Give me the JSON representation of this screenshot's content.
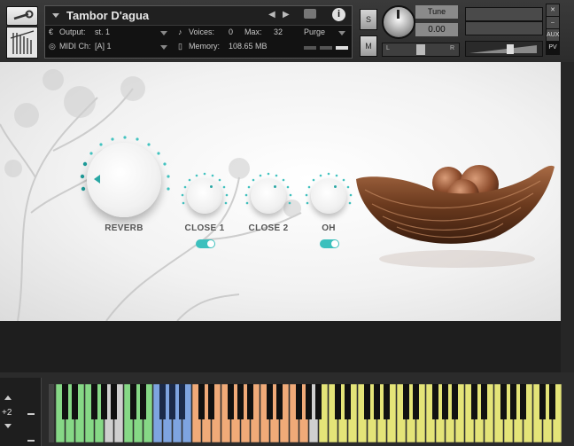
{
  "header": {
    "instrument_name": "Tambor D'agua",
    "output_label": "Output:",
    "output_value": "st. 1",
    "midi_label": "MIDI Ch:",
    "midi_value": "[A] 1",
    "voices_label": "Voices:",
    "voices_value": "0",
    "max_label": "Max:",
    "max_value": "32",
    "memory_label": "Memory:",
    "memory_value": "108.65 MB",
    "purge_label": "Purge",
    "solo_label": "S",
    "mute_label": "M",
    "tune_label": "Tune",
    "tune_value": "0.00",
    "pan_left": "L",
    "pan_right": "R",
    "aux_label": "AUX",
    "pv_label": "PV"
  },
  "controls": {
    "reverb_label": "REVERB",
    "close1_label": "CLOSE 1",
    "close2_label": "CLOSE 2",
    "oh_label": "OH"
  },
  "keyboard": {
    "octave_value": "+2"
  },
  "colors": {
    "accent": "#3cc0bd",
    "key_green": "#86d886",
    "key_blue": "#7ea4e0",
    "key_orange": "#f0aa78",
    "key_yellow": "#e4e478"
  }
}
